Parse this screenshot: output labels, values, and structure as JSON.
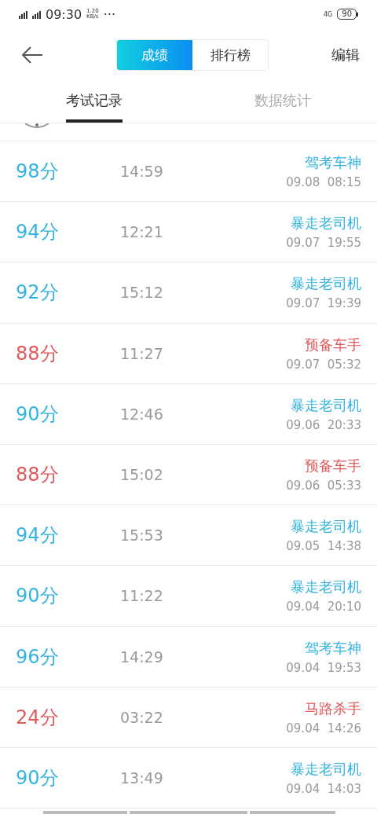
{
  "status_bar": {
    "time": "09:30",
    "speed": "1.20",
    "speed_unit": "KB/s",
    "more": "···",
    "network": "4G",
    "battery": "90"
  },
  "header": {
    "segments": [
      {
        "label": "成绩",
        "selected": true
      },
      {
        "label": "排行榜",
        "selected": false
      }
    ],
    "action": "编辑"
  },
  "tabs": [
    {
      "label": "考试记录",
      "selected": true
    },
    {
      "label": "数据统计",
      "selected": false
    }
  ],
  "records": [
    {
      "score": "98分",
      "duration": "14:59",
      "title": "驾考车神",
      "date": "09.08  08:15",
      "color": "#33b3e0"
    },
    {
      "score": "94分",
      "duration": "12:21",
      "title": "暴走老司机",
      "date": "09.07  19:55",
      "color": "#33b3e0"
    },
    {
      "score": "92分",
      "duration": "15:12",
      "title": "暴走老司机",
      "date": "09.07  19:39",
      "color": "#33b3e0"
    },
    {
      "score": "88分",
      "duration": "11:27",
      "title": "预备车手",
      "date": "09.07  05:32",
      "color": "#e05a5a"
    },
    {
      "score": "90分",
      "duration": "12:46",
      "title": "暴走老司机",
      "date": "09.06  20:33",
      "color": "#33b3e0"
    },
    {
      "score": "88分",
      "duration": "15:02",
      "title": "预备车手",
      "date": "09.06  05:33",
      "color": "#e05a5a"
    },
    {
      "score": "94分",
      "duration": "15:53",
      "title": "暴走老司机",
      "date": "09.05  14:38",
      "color": "#33b3e0"
    },
    {
      "score": "90分",
      "duration": "11:22",
      "title": "暴走老司机",
      "date": "09.04  20:10",
      "color": "#33b3e0"
    },
    {
      "score": "96分",
      "duration": "14:29",
      "title": "驾考车神",
      "date": "09.04  19:53",
      "color": "#33b3e0"
    },
    {
      "score": "24分",
      "duration": "03:22",
      "title": "马路杀手",
      "date": "09.04  14:26",
      "color": "#e05a5a"
    },
    {
      "score": "90分",
      "duration": "13:49",
      "title": "暴走老司机",
      "date": "09.04  14:03",
      "color": "#33b3e0"
    }
  ]
}
